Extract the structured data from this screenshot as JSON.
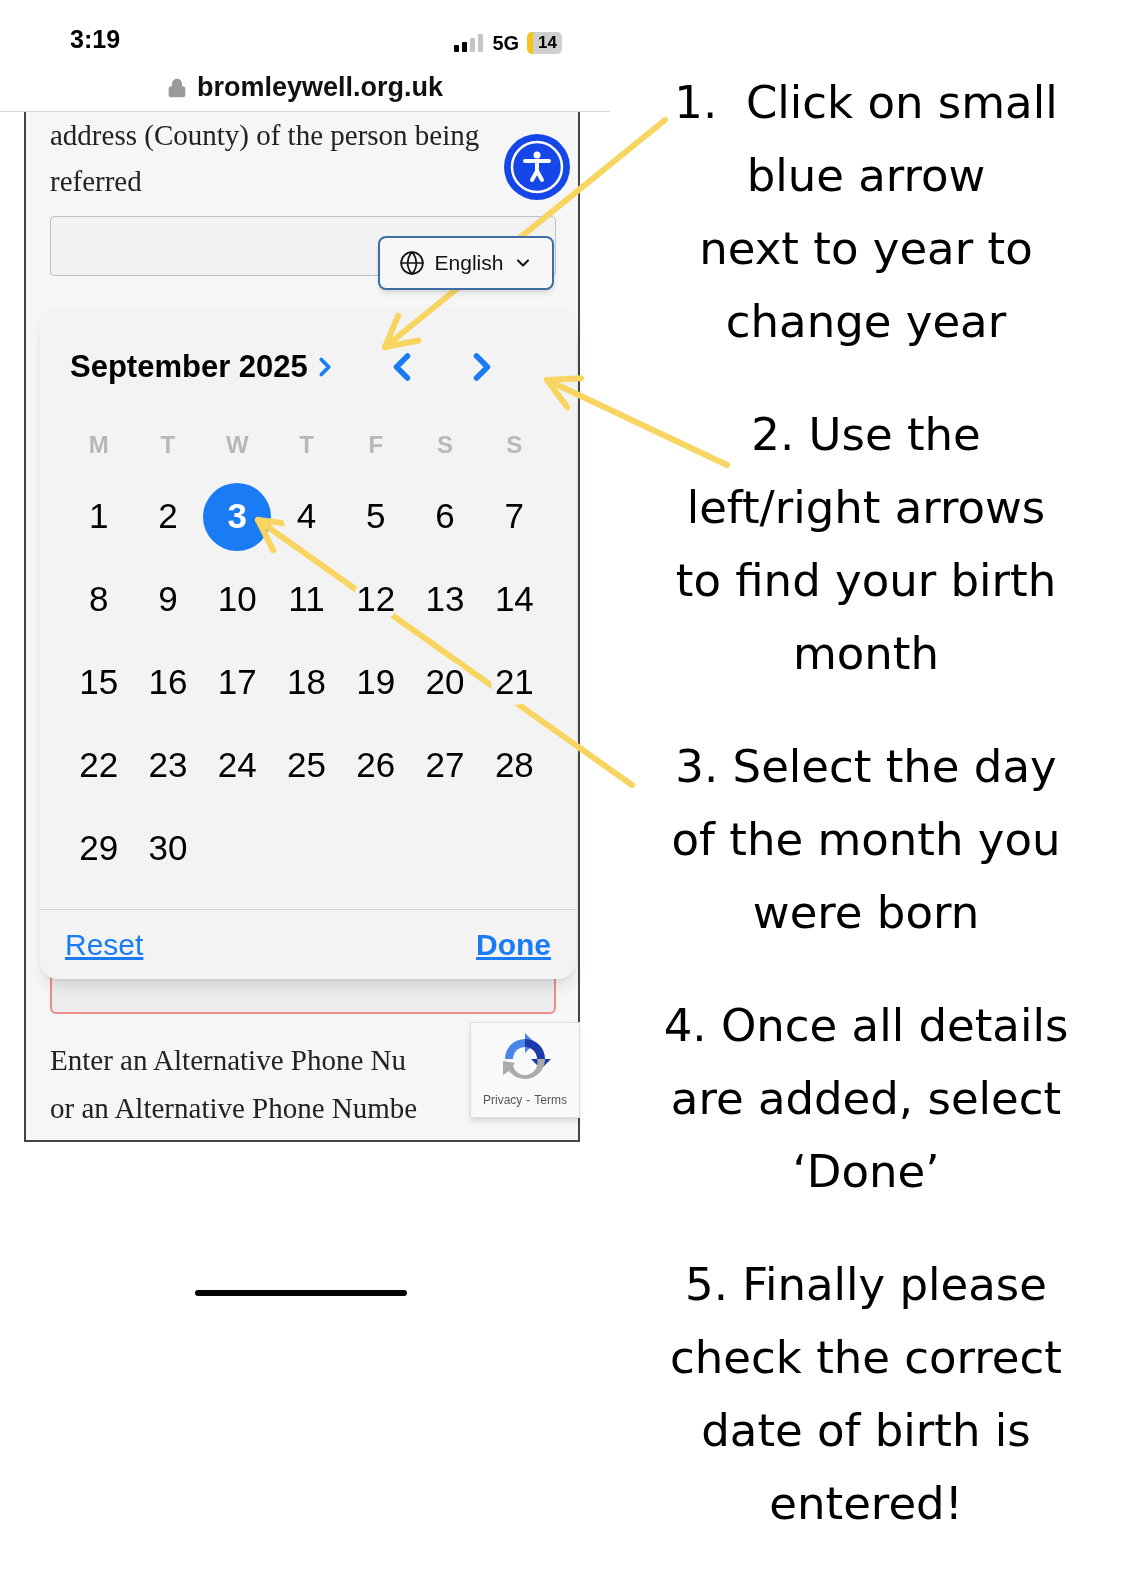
{
  "status_bar": {
    "time": "3:19",
    "network": "5G",
    "battery": "14"
  },
  "address_bar": {
    "url": "bromleywell.org.uk"
  },
  "page": {
    "question_lines": [
      "address (County) of the person being",
      "referred"
    ],
    "language_button": "English",
    "next_lines": [
      "Enter an Alternative Phone Nu",
      "or an Alternative Phone Numbe"
    ],
    "recaptcha": {
      "privacy": "Privacy",
      "separator": "-",
      "terms": "Terms"
    }
  },
  "date_picker": {
    "month_year": "September 2025",
    "weekdays": [
      "M",
      "T",
      "W",
      "T",
      "F",
      "S",
      "S"
    ],
    "days": [
      {
        "label": "1",
        "selected": false
      },
      {
        "label": "2",
        "selected": false
      },
      {
        "label": "3",
        "selected": true
      },
      {
        "label": "4",
        "selected": false
      },
      {
        "label": "5",
        "selected": false
      },
      {
        "label": "6",
        "selected": false
      },
      {
        "label": "7",
        "selected": false
      },
      {
        "label": "8",
        "selected": false
      },
      {
        "label": "9",
        "selected": false
      },
      {
        "label": "10",
        "selected": false
      },
      {
        "label": "11",
        "selected": false
      },
      {
        "label": "12",
        "selected": false
      },
      {
        "label": "13",
        "selected": false
      },
      {
        "label": "14",
        "selected": false
      },
      {
        "label": "15",
        "selected": false
      },
      {
        "label": "16",
        "selected": false
      },
      {
        "label": "17",
        "selected": false
      },
      {
        "label": "18",
        "selected": false
      },
      {
        "label": "19",
        "selected": false
      },
      {
        "label": "20",
        "selected": false
      },
      {
        "label": "21",
        "selected": false
      },
      {
        "label": "22",
        "selected": false
      },
      {
        "label": "23",
        "selected": false
      },
      {
        "label": "24",
        "selected": false
      },
      {
        "label": "25",
        "selected": false
      },
      {
        "label": "26",
        "selected": false
      },
      {
        "label": "27",
        "selected": false
      },
      {
        "label": "28",
        "selected": false
      },
      {
        "label": "29",
        "selected": false
      },
      {
        "label": "30",
        "selected": false
      }
    ],
    "reset": "Reset",
    "done": "Done"
  },
  "instructions": [
    {
      "lines": [
        "1.  Click on small",
        "blue arrow",
        "next to year to",
        "change year"
      ]
    },
    {
      "lines": [
        "2. Use the",
        "left/right arrows",
        "to find your birth",
        "month"
      ]
    },
    {
      "lines": [
        "3. Select the day",
        "of the month you",
        "were born"
      ]
    },
    {
      "lines": [
        "4. Once all details",
        "are added, select",
        "‘Done’"
      ]
    },
    {
      "lines": [
        "5. Finally please",
        "check the correct",
        "date of birth is",
        "entered!"
      ]
    }
  ]
}
